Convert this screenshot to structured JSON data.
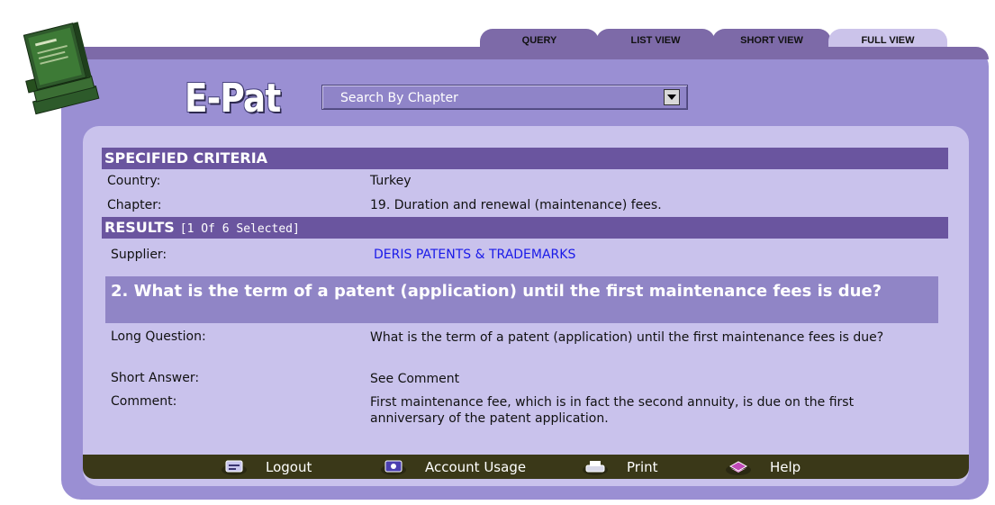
{
  "tabs": [
    "QUERY",
    "LIST VIEW",
    "SHORT VIEW",
    "FULL VIEW"
  ],
  "active_tab": "FULL VIEW",
  "brand": "E-Pat",
  "search": {
    "selected": "Search By Chapter"
  },
  "criteria": {
    "heading": "SPECIFIED CRITERIA",
    "country_label": "Country:",
    "country_value": "Turkey",
    "chapter_label": "Chapter:",
    "chapter_value": "19. Duration and renewal (maintenance) fees."
  },
  "results": {
    "heading": "RESULTS",
    "selection": "[1 Of 6 Selected]",
    "supplier_label": "Supplier:",
    "supplier_value": "DERIS PATENTS & TRADEMARKS"
  },
  "question": {
    "title": "2. What is the term of a patent (application) until the first maintenance fees is due?",
    "long_label": "Long Question:",
    "long_value": "What is the term of a patent (application) until the first maintenance fees is due?",
    "short_label": "Short Answer:",
    "short_value": "See Comment",
    "comment_label": "Comment:",
    "comment_value": "First maintenance fee, which is in fact the second annuity, is due on the first anniversary of the patent application."
  },
  "footer": {
    "logout": "Logout",
    "account_usage": "Account Usage",
    "print": "Print",
    "help": "Help"
  },
  "colors": {
    "frame": "#9a8fd3",
    "panel": "#c9c2ec",
    "header_bar": "#6a559f",
    "question_bar": "#9085c6",
    "footer": "#3a3818",
    "link": "#1a1ae8"
  }
}
